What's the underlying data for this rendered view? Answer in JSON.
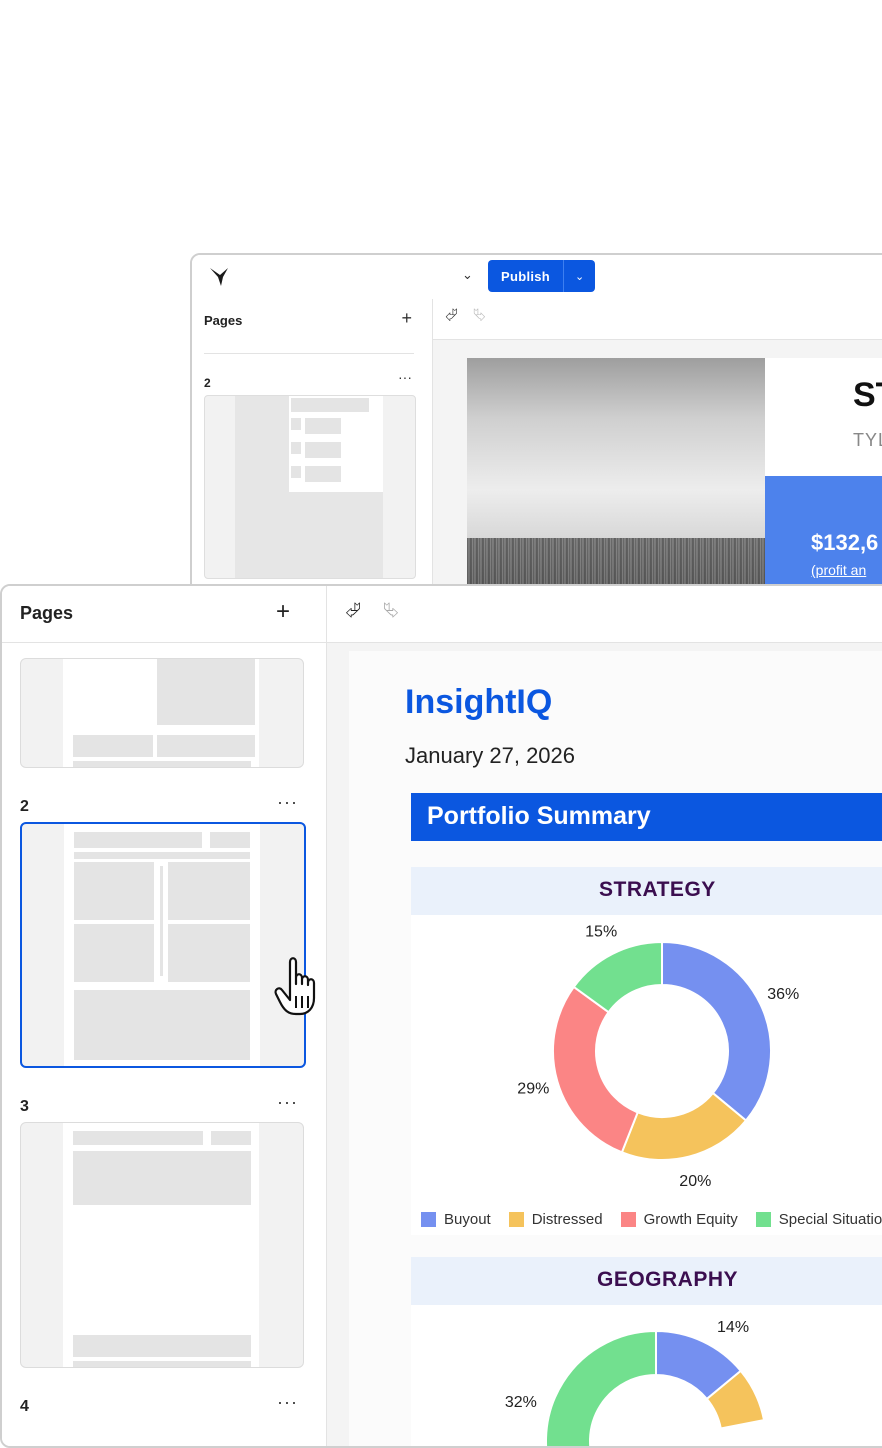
{
  "back_window": {
    "publish_label": "Publish",
    "pages_title": "Pages",
    "pages_add": "+",
    "page_number": "2",
    "page_more": "···",
    "doc_title_fragment": "ST",
    "doc_subtitle_fragment": "TYL",
    "amount_fragment": "$132,6",
    "amount_note_fragment": "(profit an"
  },
  "front_window": {
    "pages_title": "Pages",
    "pages_add": "+",
    "pages": [
      {
        "number": "",
        "more": ""
      },
      {
        "number": "2",
        "more": "···",
        "selected": true
      },
      {
        "number": "3",
        "more": "···"
      },
      {
        "number": "4",
        "more": "···"
      }
    ]
  },
  "document": {
    "title": "InsightIQ",
    "date": "January 27, 2026",
    "summary_title": "Portfolio Summary",
    "strategy_title": "STRATEGY",
    "geography_title": "GEOGRAPHY"
  },
  "colors": {
    "accent": "#0b57e0",
    "section_bg": "#eaf1fb",
    "section_text": "#3b0e4f"
  },
  "chart_data": [
    {
      "type": "pie",
      "title": "STRATEGY",
      "donut": true,
      "categories": [
        "Buyout",
        "Distressed",
        "Growth Equity",
        "Special Situatio"
      ],
      "values": [
        36,
        20,
        29,
        15
      ],
      "labels": [
        "36%",
        "20%",
        "29%",
        "15%"
      ],
      "colors": [
        "#7590f0",
        "#f5c35c",
        "#fb8585",
        "#72e08f"
      ],
      "legend": "bottom"
    },
    {
      "type": "pie",
      "title": "GEOGRAPHY",
      "donut": true,
      "values": [
        14,
        32
      ],
      "labels": [
        "14%",
        "32%"
      ],
      "colors": [
        "#7590f0",
        "#72e08f"
      ],
      "partial": true
    }
  ]
}
